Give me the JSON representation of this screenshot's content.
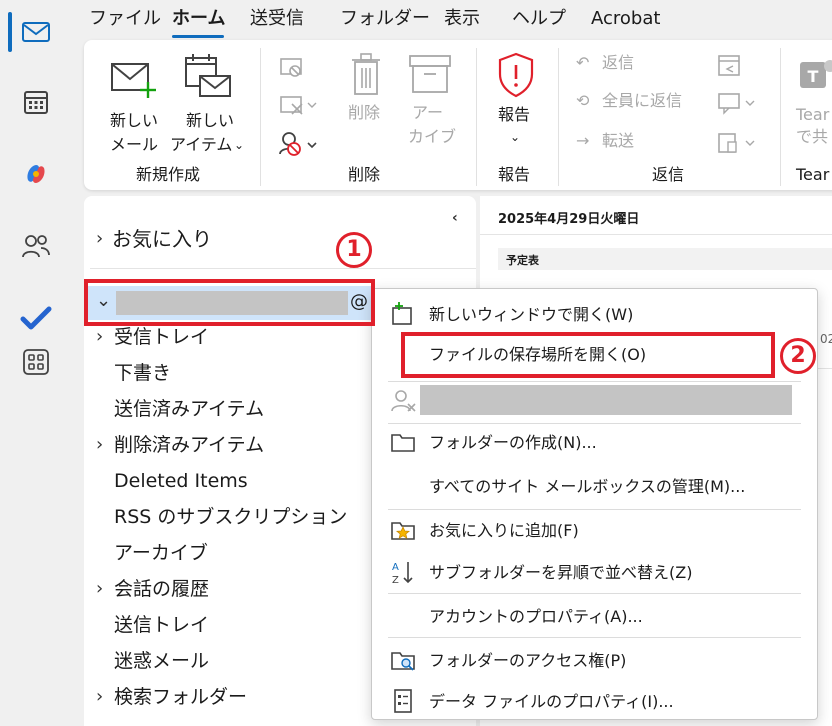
{
  "rail": {
    "active_color": "#0f6cbd",
    "icons": [
      "mail-icon",
      "calendar-icon",
      "copilot-icon",
      "people-icon",
      "todo-icon",
      "apps-icon"
    ]
  },
  "tabs": [
    "ファイル",
    "ホーム",
    "送受信",
    "フォルダー",
    "表示",
    "ヘルプ",
    "Acrobat"
  ],
  "active_tab": "ホーム",
  "ribbon": {
    "new_mail_line1": "新しい",
    "new_mail_line2": "メール",
    "new_item_line1": "新しい",
    "new_item_line2": "アイテム",
    "group_new": "新規作成",
    "delete_label": "削除",
    "archive_line1": "アー",
    "archive_line2": "カイブ",
    "group_delete": "削除",
    "report_label": "報告",
    "group_report": "報告",
    "reply": "返信",
    "reply_all": "全員に返信",
    "forward": "転送",
    "group_reply": "返信",
    "teams_line1": "Tear",
    "teams_line2": "で共",
    "group_teams": "Tear"
  },
  "folder_pane": {
    "favorites": "お気に入り",
    "account_at": "@",
    "folders": [
      {
        "label": "受信トレイ",
        "expandable": true
      },
      {
        "label": "下書き",
        "expandable": false
      },
      {
        "label": "送信済みアイテム",
        "expandable": false
      },
      {
        "label": "削除済みアイテム",
        "expandable": true
      },
      {
        "label": "Deleted Items",
        "expandable": false
      },
      {
        "label": "RSS のサブスクリプション",
        "expandable": false
      },
      {
        "label": "アーカイブ",
        "expandable": false
      },
      {
        "label": "会話の履歴",
        "expandable": true
      },
      {
        "label": "送信トレイ",
        "expandable": false
      },
      {
        "label": "迷惑メール",
        "expandable": false
      },
      {
        "label": "検索フォルダー",
        "expandable": true
      }
    ]
  },
  "reading": {
    "date": "2025年4月29日火曜日",
    "schedule": "予定表",
    "partial": "02"
  },
  "context_menu": {
    "items": {
      "open_new_window": "新しいウィンドウで開く(W)",
      "open_file_location": "ファイルの保存場所を開く(O)",
      "create_folder": "フォルダーの作成(N)...",
      "manage_site_mailboxes": "すべてのサイト メールボックスの管理(M)...",
      "add_to_favorites": "お気に入りに追加(F)",
      "sort_subfolders": "サブフォルダーを昇順で並べ替え(Z)",
      "account_properties": "アカウントのプロパティ(A)...",
      "folder_permissions": "フォルダーのアクセス権(P)",
      "data_file_properties": "データ ファイルのプロパティ(I)..."
    }
  },
  "annotations": {
    "step1": "1",
    "step2": "2",
    "highlight_color": "#e0202b"
  }
}
